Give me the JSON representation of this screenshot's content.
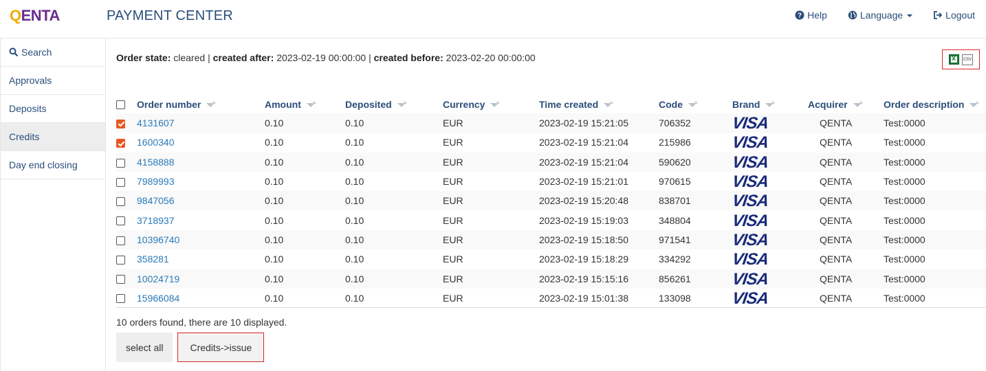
{
  "header": {
    "logo_q": "Q",
    "logo_rest": "ENTA",
    "title": "PAYMENT CENTER",
    "nav": {
      "help": "Help",
      "language": "Language",
      "logout": "Logout"
    },
    "brand_colors": {
      "logo_purple": "#6b2a8f",
      "logo_yellow": "#f2a900",
      "nav_blue": "#2a4d7a"
    }
  },
  "sidebar": {
    "items": [
      {
        "label": "Search",
        "icon": "search-icon",
        "active": false
      },
      {
        "label": "Approvals",
        "active": false
      },
      {
        "label": "Deposits",
        "active": false
      },
      {
        "label": "Credits",
        "active": true
      },
      {
        "label": "Day end closing",
        "active": false
      }
    ]
  },
  "filter": {
    "state_label": "Order state:",
    "state_value": "cleared",
    "after_label": "created after:",
    "after_value": "2023-02-19 00:00:00",
    "before_label": "created before:",
    "before_value": "2023-02-20 00:00:00",
    "separator": "|"
  },
  "export": {
    "xls_icon": "excel-icon",
    "csv_icon": "csv-icon",
    "csv_text": "CSV"
  },
  "table": {
    "columns": [
      "Order number",
      "Amount",
      "Deposited",
      "Currency",
      "Time created",
      "Code",
      "Brand",
      "Acquirer",
      "Order description"
    ],
    "rows": [
      {
        "checked": true,
        "order": "4131607",
        "amount": "0.10",
        "deposited": "0.10",
        "currency": "EUR",
        "time": "2023-02-19 15:21:05",
        "code": "706352",
        "brand": "VISA",
        "acquirer": "QENTA",
        "desc": "Test:0000"
      },
      {
        "checked": true,
        "order": "1600340",
        "amount": "0.10",
        "deposited": "0.10",
        "currency": "EUR",
        "time": "2023-02-19 15:21:04",
        "code": "215986",
        "brand": "VISA",
        "acquirer": "QENTA",
        "desc": "Test:0000"
      },
      {
        "checked": false,
        "order": "4158888",
        "amount": "0.10",
        "deposited": "0.10",
        "currency": "EUR",
        "time": "2023-02-19 15:21:04",
        "code": "590620",
        "brand": "VISA",
        "acquirer": "QENTA",
        "desc": "Test:0000"
      },
      {
        "checked": false,
        "order": "7989993",
        "amount": "0.10",
        "deposited": "0.10",
        "currency": "EUR",
        "time": "2023-02-19 15:21:01",
        "code": "970615",
        "brand": "VISA",
        "acquirer": "QENTA",
        "desc": "Test:0000"
      },
      {
        "checked": false,
        "order": "9847056",
        "amount": "0.10",
        "deposited": "0.10",
        "currency": "EUR",
        "time": "2023-02-19 15:20:48",
        "code": "838701",
        "brand": "VISA",
        "acquirer": "QENTA",
        "desc": "Test:0000"
      },
      {
        "checked": false,
        "order": "3718937",
        "amount": "0.10",
        "deposited": "0.10",
        "currency": "EUR",
        "time": "2023-02-19 15:19:03",
        "code": "348804",
        "brand": "VISA",
        "acquirer": "QENTA",
        "desc": "Test:0000"
      },
      {
        "checked": false,
        "order": "10396740",
        "amount": "0.10",
        "deposited": "0.10",
        "currency": "EUR",
        "time": "2023-02-19 15:18:50",
        "code": "971541",
        "brand": "VISA",
        "acquirer": "QENTA",
        "desc": "Test:0000"
      },
      {
        "checked": false,
        "order": "358281",
        "amount": "0.10",
        "deposited": "0.10",
        "currency": "EUR",
        "time": "2023-02-19 15:18:29",
        "code": "334292",
        "brand": "VISA",
        "acquirer": "QENTA",
        "desc": "Test:0000"
      },
      {
        "checked": false,
        "order": "10024719",
        "amount": "0.10",
        "deposited": "0.10",
        "currency": "EUR",
        "time": "2023-02-19 15:15:16",
        "code": "856261",
        "brand": "VISA",
        "acquirer": "QENTA",
        "desc": "Test:0000"
      },
      {
        "checked": false,
        "order": "15966084",
        "amount": "0.10",
        "deposited": "0.10",
        "currency": "EUR",
        "time": "2023-02-19 15:01:38",
        "code": "133098",
        "brand": "VISA",
        "acquirer": "QENTA",
        "desc": "Test:0000"
      }
    ]
  },
  "summary": "10 orders found, there are 10 displayed.",
  "buttons": {
    "select_all": "select all",
    "issue": "Credits->issue"
  },
  "colors": {
    "checkbox_checked": "#e8581f",
    "link": "#2a7ab8",
    "highlight_border": "#d9232d",
    "visa": "#1a2a7a"
  }
}
